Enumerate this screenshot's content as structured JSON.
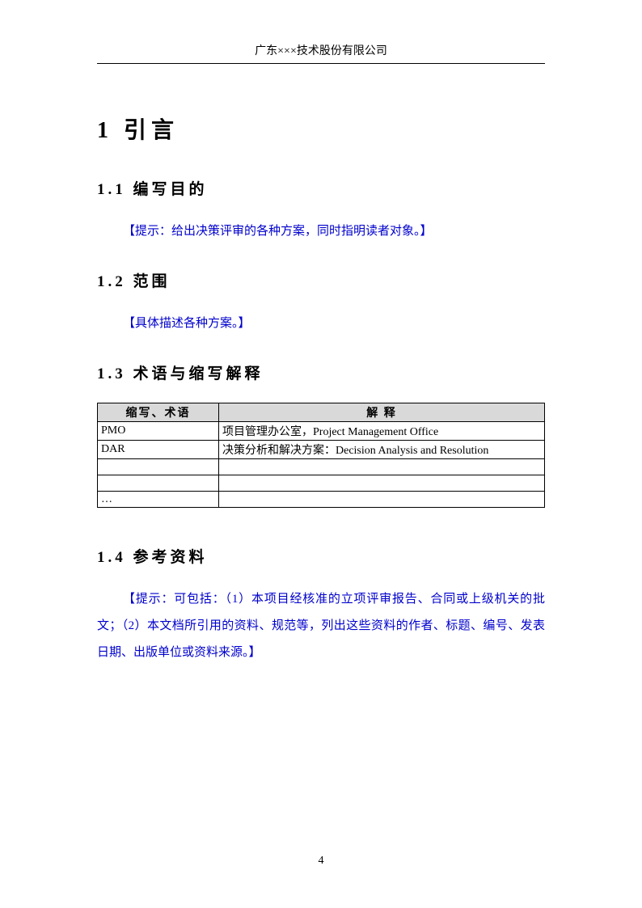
{
  "header": "广东×××技术股份有限公司",
  "h1": "1 引言",
  "sections": {
    "s1_1": {
      "title": "1.1 编写目的",
      "hint": "【提示：给出决策评审的各种方案，同时指明读者对象。】"
    },
    "s1_2": {
      "title": "1.2 范围",
      "hint": "【具体描述各种方案。】"
    },
    "s1_3": {
      "title": "1.3 术语与缩写解释",
      "table": {
        "headers": {
          "col1": "缩写、术语",
          "col2": "解 释"
        },
        "rows": [
          {
            "c1": "PMO",
            "c2": "项目管理办公室，Project Management Office"
          },
          {
            "c1": "DAR",
            "c2": "决策分析和解决方案：Decision Analysis and Resolution"
          },
          {
            "c1": "",
            "c2": ""
          },
          {
            "c1": "",
            "c2": ""
          },
          {
            "c1": "…",
            "c2": ""
          }
        ]
      }
    },
    "s1_4": {
      "title": "1.4 参考资料",
      "hint": "【提示：可包括：（1）本项目经核准的立项评审报告、合同或上级机关的批文；（2）本文档所引用的资料、规范等，列出这些资料的作者、标题、编号、发表日期、出版单位或资料来源。】"
    }
  },
  "page_number": "4"
}
